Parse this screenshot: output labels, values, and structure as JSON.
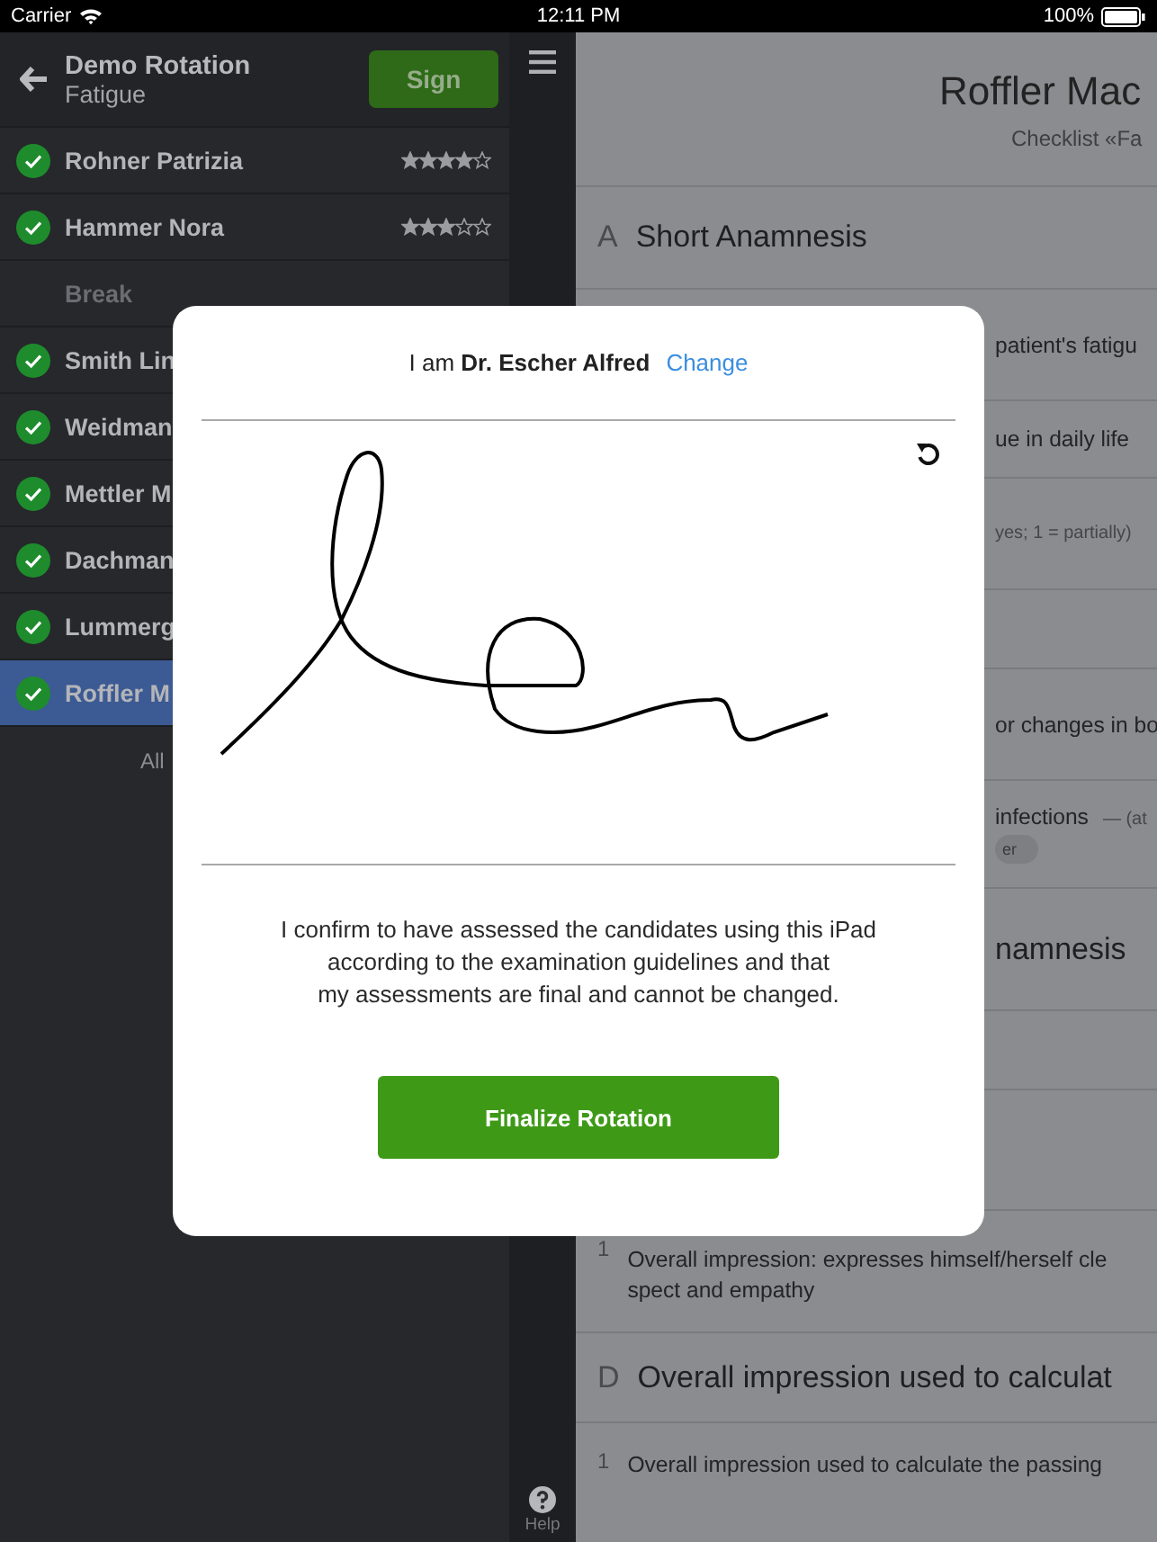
{
  "status_bar": {
    "carrier": "Carrier",
    "time": "12:11 PM",
    "battery": "100%"
  },
  "sidebar": {
    "title": "Demo Rotation",
    "subtitle": "Fatigue",
    "sign_button": "Sign",
    "items": [
      {
        "kind": "candidate",
        "name": "Rohner Patrizia",
        "done": true,
        "stars": 4,
        "selected": false
      },
      {
        "kind": "candidate",
        "name": "Hammer Nora",
        "done": true,
        "stars": 3,
        "selected": false
      },
      {
        "kind": "break",
        "name": "Break"
      },
      {
        "kind": "candidate",
        "name": "Smith Lin",
        "done": true,
        "selected": false
      },
      {
        "kind": "candidate",
        "name": "Weidman",
        "done": true,
        "selected": false
      },
      {
        "kind": "candidate",
        "name": "Mettler M",
        "done": true,
        "selected": false
      },
      {
        "kind": "candidate",
        "name": "Dachman",
        "done": true,
        "selected": false
      },
      {
        "kind": "candidate",
        "name": "Lummerg",
        "done": true,
        "selected": false
      },
      {
        "kind": "candidate",
        "name": "Roffler M",
        "done": true,
        "selected": true
      }
    ],
    "footer": "All"
  },
  "toolbar": {
    "help": "Help"
  },
  "main": {
    "title": "Roffler Mac",
    "subtitle": "Checklist «Fa",
    "rows": [
      {
        "kind": "section",
        "letter": "A",
        "text": "Short Anamnesis"
      },
      {
        "kind": "item",
        "text": "patient's fatigu"
      },
      {
        "kind": "item",
        "text": "ue in daily life"
      },
      {
        "kind": "note",
        "text": "yes; 1 = partially)"
      },
      {
        "kind": "blank"
      },
      {
        "kind": "item",
        "text": "or changes in bo"
      },
      {
        "kind": "item",
        "text": "infections",
        "aside": "— (at",
        "pill": "er"
      },
      {
        "kind": "section",
        "text": "namnesis"
      },
      {
        "kind": "blank"
      },
      {
        "kind": "blank"
      },
      {
        "kind": "item",
        "number": "1",
        "lines": [
          "Overall impression: expresses himself/herself cle",
          "spect and empathy"
        ]
      },
      {
        "kind": "section",
        "letter": "D",
        "text": "Overall impression used to calculat"
      },
      {
        "kind": "item",
        "number": "1",
        "text": "Overall impression used to calculate the passing"
      }
    ]
  },
  "dialog": {
    "intro": "I am **Dr. Escher Alfred**",
    "change_link": "Change",
    "confirmation": "I confirm to have assessed the candidates using this iPad\naccording to the examination guidelines and that\nmy assessments are final and cannot be changed.",
    "button": "Finalize Rotation"
  }
}
